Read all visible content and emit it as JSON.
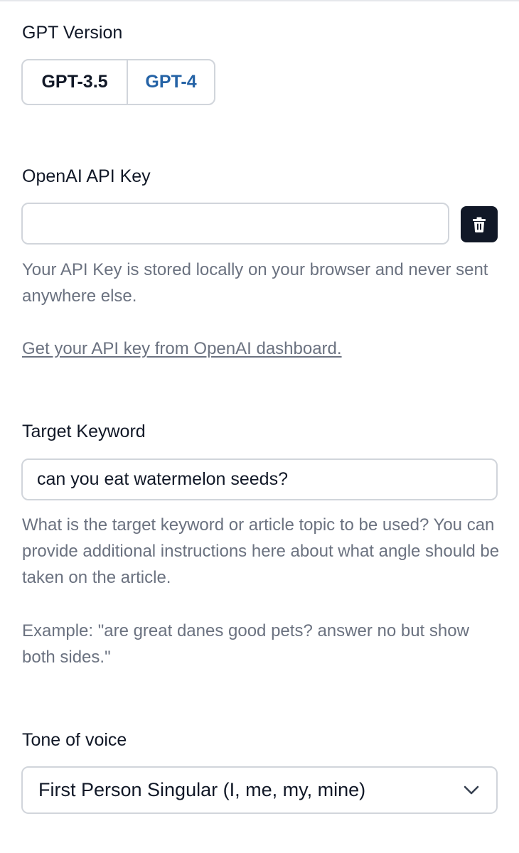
{
  "gpt_version": {
    "label": "GPT Version",
    "options": [
      "GPT-3.5",
      "GPT-4"
    ],
    "selected": "GPT-3.5"
  },
  "api_key": {
    "label": "OpenAI API Key",
    "value": "",
    "placeholder": "",
    "delete_icon": "trash-icon",
    "helper": "Your API Key is stored locally on your browser and never sent anywhere else.",
    "link_text": "Get your API key from OpenAI dashboard."
  },
  "target_keyword": {
    "label": "Target Keyword",
    "value": "can you eat watermelon seeds?",
    "helper": "What is the target keyword or article topic to be used? You can provide additional instructions here about what angle should be taken on the article.",
    "example": "Example: \"are great danes good pets? answer no but show both sides.\""
  },
  "tone_of_voice": {
    "label": "Tone of voice",
    "selected": "First Person Singular (I, me, my, mine)",
    "icon": "chevron-down-icon"
  },
  "colors": {
    "accent": "#2563a6",
    "button_dark": "#111827",
    "helper_text": "#6b7280",
    "border": "#d1d5db"
  }
}
